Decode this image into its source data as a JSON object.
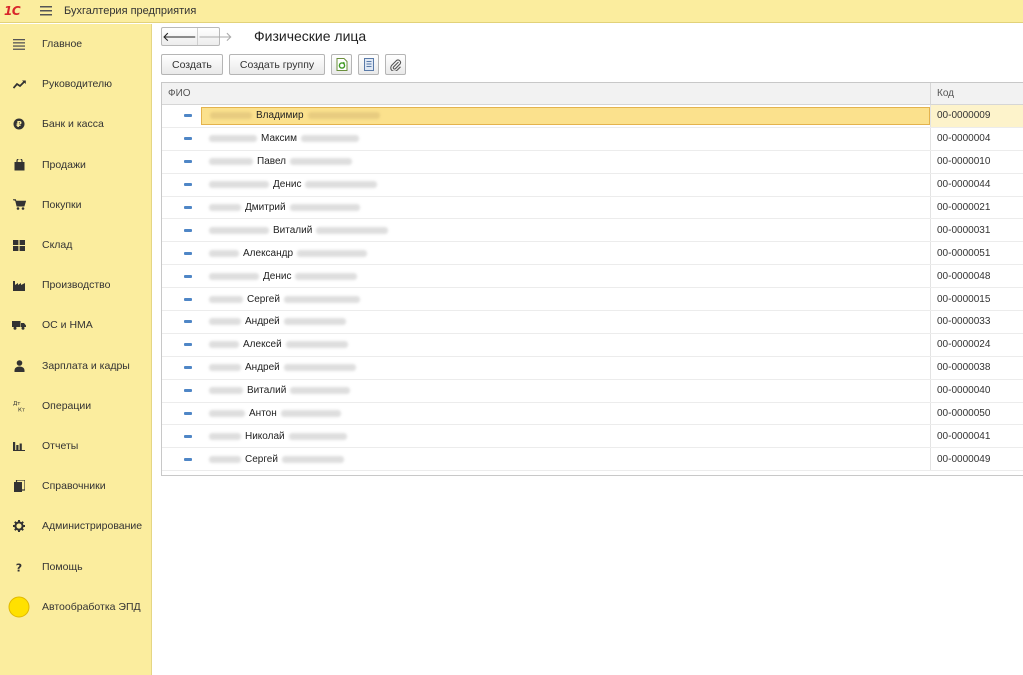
{
  "app": {
    "logo": "1С",
    "title": "Бухгалтерия предприятия"
  },
  "sidebar": {
    "items": [
      {
        "label": "Главное",
        "icon": "list-icon"
      },
      {
        "label": "Руководителю",
        "icon": "trend-icon"
      },
      {
        "label": "Банк и касса",
        "icon": "coin-icon"
      },
      {
        "label": "Продажи",
        "icon": "bag-icon"
      },
      {
        "label": "Покупки",
        "icon": "cart-icon"
      },
      {
        "label": "Склад",
        "icon": "warehouse-icon"
      },
      {
        "label": "Производство",
        "icon": "factory-icon"
      },
      {
        "label": "ОС и НМА",
        "icon": "truck-icon"
      },
      {
        "label": "Зарплата и кадры",
        "icon": "person-icon"
      },
      {
        "label": "Операции",
        "icon": "dt-kt-icon"
      },
      {
        "label": "Отчеты",
        "icon": "bar-chart-icon"
      },
      {
        "label": "Справочники",
        "icon": "book-icon"
      },
      {
        "label": "Администрирование",
        "icon": "gear-icon"
      },
      {
        "label": "Помощь",
        "icon": "question-icon"
      },
      {
        "label": "Автообработка ЭПД",
        "icon": "yellow-circle-icon"
      }
    ]
  },
  "page": {
    "title": "Физические лица",
    "back_arrow": "🡐",
    "forward_arrow": "🡒"
  },
  "toolbar": {
    "create_label": "Создать",
    "create_group_label": "Создать группу"
  },
  "grid": {
    "columns": [
      "ФИО",
      "Код"
    ],
    "rows": [
      {
        "first_name": "Владимир",
        "code": "00-0000009",
        "selected": true
      },
      {
        "first_name": "Максим",
        "code": "00-0000004"
      },
      {
        "first_name": "Павел",
        "code": "00-0000010"
      },
      {
        "first_name": "Денис",
        "code": "00-0000044"
      },
      {
        "first_name": "Дмитрий",
        "code": "00-0000021"
      },
      {
        "first_name": "Виталий",
        "code": "00-0000031"
      },
      {
        "first_name": "Александр",
        "code": "00-0000051"
      },
      {
        "first_name": "Денис",
        "code": "00-0000048"
      },
      {
        "first_name": "Сергей",
        "code": "00-0000015"
      },
      {
        "first_name": "Андрей",
        "code": "00-0000033"
      },
      {
        "first_name": "Алексей",
        "code": "00-0000024"
      },
      {
        "first_name": "Андрей",
        "code": "00-0000038"
      },
      {
        "first_name": "Виталий",
        "code": "00-0000040"
      },
      {
        "first_name": "Антон",
        "code": "00-0000050"
      },
      {
        "first_name": "Николай",
        "code": "00-0000041"
      },
      {
        "first_name": "Сергей",
        "code": "00-0000049"
      }
    ]
  },
  "colors": {
    "panel_bg": "#fbed9e",
    "selection": "#fbe18d",
    "row_marker": "#4f86c6",
    "logo_red": "#d8262b"
  }
}
